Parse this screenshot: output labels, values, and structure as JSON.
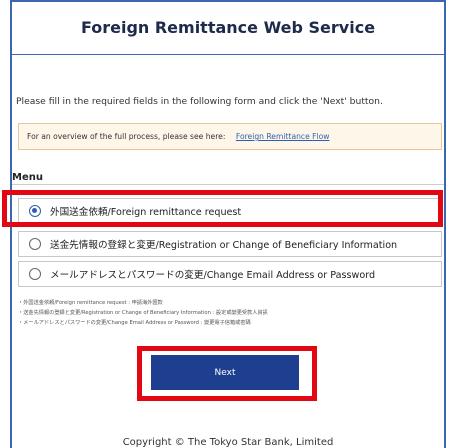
{
  "header": {
    "title": "Foreign Remittance Web Service"
  },
  "instructions": "Please fill in the required fields in the following form and click the 'Next' button.",
  "notice": {
    "text": "For an overview of the full process, please see here:",
    "link_text": "Foreign Remittance Flow"
  },
  "menu": {
    "label": "Menu",
    "options": [
      {
        "label": "外国送金依頼/Foreign remittance request",
        "selected": true
      },
      {
        "label": "送金先情報の登録と変更/Registration or Change of Beneficiary Information",
        "selected": false
      },
      {
        "label": "メールアドレスとパスワードの変更/Change Email Address or Password",
        "selected": false
      }
    ]
  },
  "notes": [
    "・外国送金依頼/Foreign remittance request : 申請海外匯款",
    "・送金先情報の登録と変更/Registration or Change of Beneficiary Information : 設定或變更受款人資訊",
    "・メールアドレスとパスワードの変更/Change Email Address or Password : 變更電子信箱或密碼"
  ],
  "next_button": {
    "label": "Next"
  },
  "footer": {
    "copyright": "Copyright © The Tokyo Star Bank, Limited"
  },
  "colors": {
    "primary": "#1e3f8f",
    "highlight": "#e30613",
    "notice_bg": "#fff6ea",
    "link": "#2d5fb0"
  }
}
